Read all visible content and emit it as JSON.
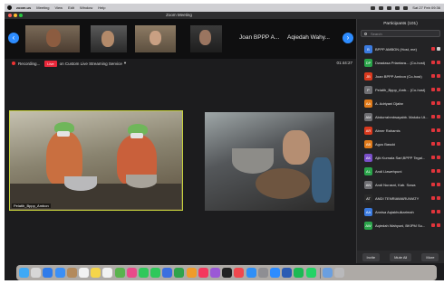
{
  "menubar": {
    "app": "zoom.us",
    "items": [
      "Meeting",
      "View",
      "Edit",
      "Window",
      "Help"
    ],
    "clock": "Sat 27 Feb 09:36"
  },
  "window": {
    "title": "Zoom Meeting"
  },
  "gallery": {
    "tile_names": [
      "Joan BPPP A...",
      "Aqiedah Wahy..."
    ]
  },
  "recording": {
    "label": "Recording...",
    "live_badge": "Live",
    "stream_label": "on Custom Live Streaming Service",
    "timer": "01:44:27"
  },
  "main": {
    "left_caption": "Pelatih_Bppp_Ambon"
  },
  "participants": {
    "title": "Participants (101)",
    "search_placeholder": "Search",
    "rows": [
      {
        "initials": "B",
        "name": "BPPP AMBON (Host, me)",
        "color": "#3b7be0"
      },
      {
        "initials": "DP",
        "name": "Dwadasa Priantara... (Co-host)",
        "color": "#2aa44a"
      },
      {
        "initials": "JB",
        "name": "Joan BPPP Ambon (Co-host)",
        "color": "#d9391e"
      },
      {
        "initials": "P",
        "name": "Pelatih_Bppp_Amb... (Co-host)",
        "color": "#6f6f73"
      },
      {
        "initials": "AA",
        "name": "A. Adriyani Djafar",
        "color": "#e07a1a"
      },
      {
        "initials": "AM",
        "name": "Abdurrahmbsayabb. Maluku Ut...",
        "color": "#6f6f73"
      },
      {
        "initials": "AR",
        "name": "Abner Rahamis",
        "color": "#d9391e"
      },
      {
        "initials": "AB",
        "name": "Agus Basuki",
        "color": "#e07a1a"
      },
      {
        "initials": "AK",
        "name": "Ajik Kurnala Sari,BPPP Tegal...",
        "color": "#7a4fc9"
      },
      {
        "initials": "AL",
        "name": "Andi Llawehpuni",
        "color": "#2aa44a"
      },
      {
        "initials": "AN",
        "name": "Andi Nurasni, Kab. Sowa",
        "color": "#6f6f73"
      },
      {
        "initials": "AT",
        "name": "ANDI TENRIAWARUWATY",
        "color": "#2a2a2a"
      },
      {
        "initials": "AA",
        "name": "Annisa Aqiakhulkarimah",
        "color": "#3b7be0"
      },
      {
        "initials": "AW",
        "name": "Aqiedah Wahyuni, BKIPM Su...",
        "color": "#2aa44a"
      }
    ],
    "invite_label": "Invite",
    "mute_all_label": "Mute All",
    "more_label": "More"
  },
  "dock": {
    "icons": [
      "finder-icon",
      "launchpad-icon",
      "safari-icon",
      "mail-icon",
      "contacts-icon",
      "calendar-icon",
      "notes-icon",
      "reminders-icon",
      "maps-icon",
      "photos-icon",
      "facetime-icon",
      "messages-icon",
      "keynote-icon",
      "numbers-icon",
      "pages-icon",
      "music-icon",
      "podcasts-icon",
      "tv-icon",
      "news-icon",
      "appstore-icon",
      "settings-icon",
      "zoom-icon",
      "word-icon",
      "spotify-icon",
      "whatsapp-icon",
      "downloads-icon",
      "trash-icon"
    ],
    "colors": [
      "#3fa9f5",
      "#d7d7d7",
      "#2f7bea",
      "#3b8ff6",
      "#b38a5c",
      "#f2f2f2",
      "#f5d54a",
      "#f2f2f2",
      "#5ab34e",
      "#e94b8a",
      "#2fc85b",
      "#2fc85b",
      "#3b6fe0",
      "#2fa34b",
      "#f09c2a",
      "#f5385d",
      "#9b59d6",
      "#222",
      "#f0484e",
      "#2f8ff6",
      "#8e8e93",
      "#2d8cff",
      "#2b5bb3",
      "#1db954",
      "#25d366",
      "#6a9fe0",
      "#b9b9bb"
    ]
  }
}
